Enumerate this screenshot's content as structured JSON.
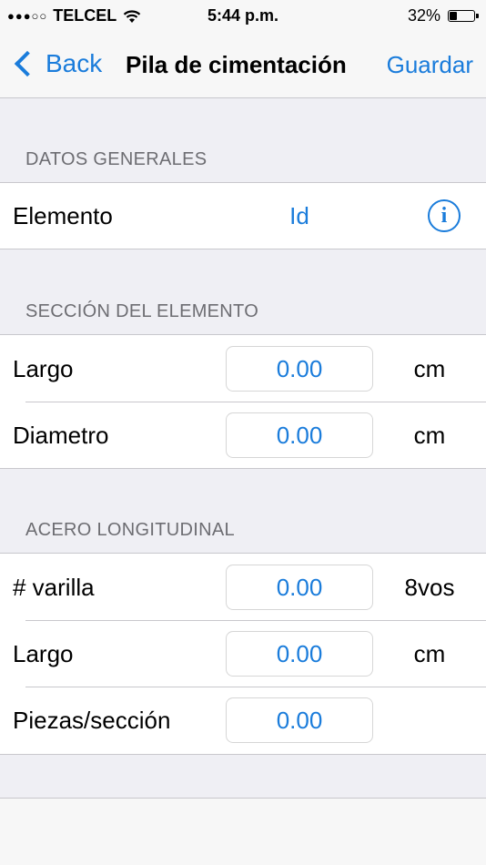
{
  "status_bar": {
    "carrier": "TELCEL",
    "time": "5:44 p.m.",
    "battery": "32%",
    "battery_level": 0.32
  },
  "nav": {
    "back_label": "Back",
    "title": "Pila de cimentación",
    "save_label": "Guardar"
  },
  "sections": {
    "general": {
      "header": "DATOS GENERALES",
      "element_label": "Elemento",
      "element_value": "Id"
    },
    "section": {
      "header": "SECCIÓN DEL ELEMENTO",
      "rows": [
        {
          "label": "Largo",
          "value": "0.00",
          "unit": "cm"
        },
        {
          "label": "Diametro",
          "value": "0.00",
          "unit": "cm"
        }
      ]
    },
    "steel": {
      "header": "ACERO LONGITUDINAL",
      "rows": [
        {
          "label": "# varilla",
          "value": "0.00",
          "unit": "8vos"
        },
        {
          "label": "Largo",
          "value": "0.00",
          "unit": "cm"
        },
        {
          "label": "Piezas/sección",
          "value": "0.00",
          "unit": ""
        }
      ]
    }
  },
  "colors": {
    "accent": "#1a7cdb",
    "background": "#efeff4",
    "separator": "#c8c7cc"
  }
}
